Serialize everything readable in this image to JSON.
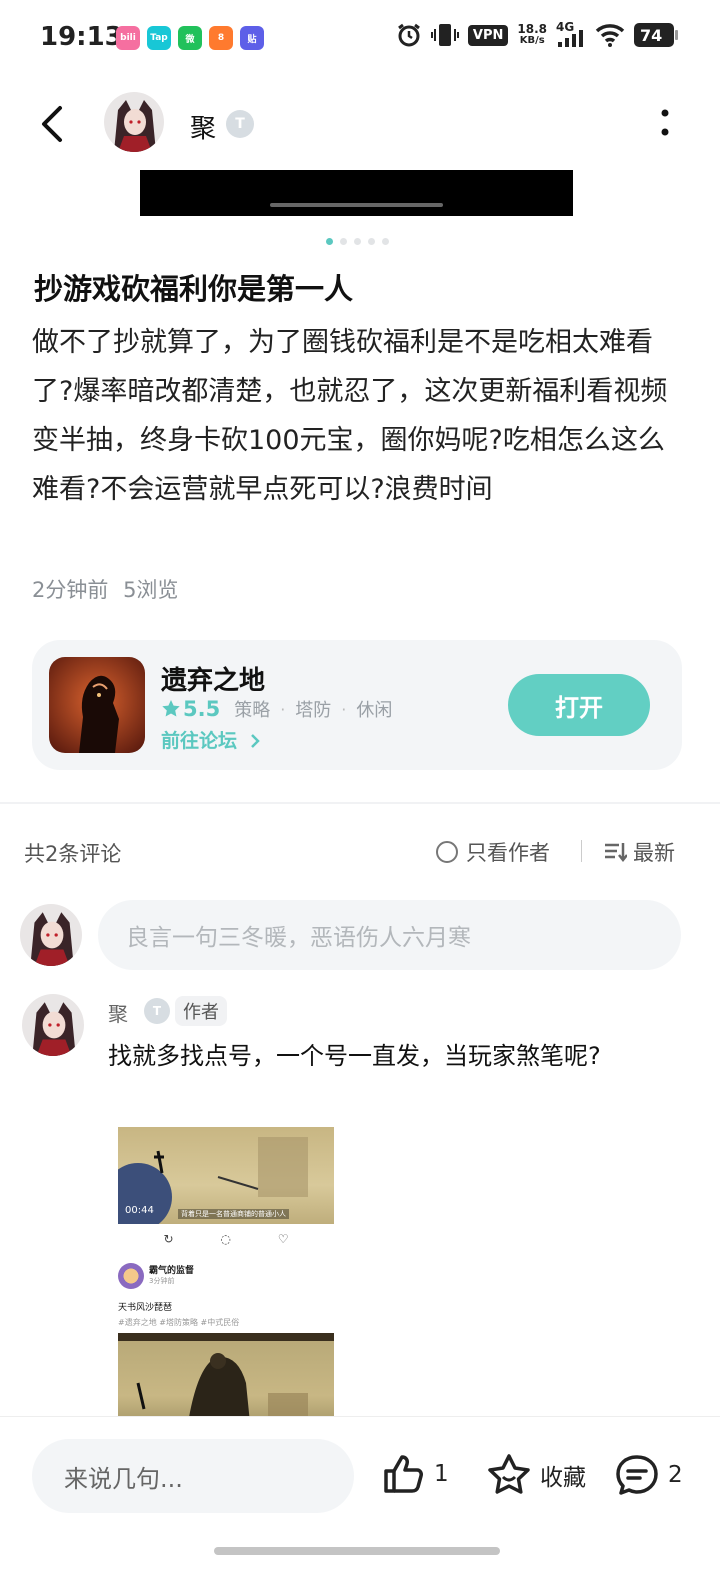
{
  "status_bar": {
    "time": "19:13",
    "apps": [
      {
        "icon": "bilibili-icon",
        "label": "bili",
        "color": "#f56fa0"
      },
      {
        "icon": "taptap-icon",
        "label": "Tap",
        "color": "#18c7d6"
      },
      {
        "icon": "wechat-icon",
        "label": "微",
        "color": "#21c15b"
      },
      {
        "icon": "app-icon",
        "label": "8",
        "color": "#ff7a2e"
      },
      {
        "icon": "app-icon",
        "label": "贴",
        "color": "#5d5fe8"
      }
    ],
    "vpn": "VPN",
    "speed_value": "18.8",
    "speed_unit": "KB/s",
    "network": "4G",
    "battery": "74"
  },
  "header": {
    "author_name": "聚",
    "level_badge": "T"
  },
  "post": {
    "title": "抄游戏砍福利你是第一人",
    "body": "做不了抄就算了，为了圈钱砍福利是不是吃相太难看了?爆率暗改都清楚，也就忍了，这次更新福利看视频变半抽，终身卡砍100元宝，圈你妈呢?吃相怎么这么难看?不会运营就早点死可以?浪费时间",
    "time_ago": "2分钟前",
    "views": "5浏览"
  },
  "game": {
    "name": "遗弃之地",
    "rating": "5.5",
    "tags": [
      "策略",
      "塔防",
      "休闲"
    ],
    "forum_link": "前往论坛",
    "open_button": "打开",
    "accent": "#5bc8c0"
  },
  "comments": {
    "count_label": "共2条评论",
    "only_author": "只看作者",
    "sort": "最新",
    "input_placeholder": "良言一句三冬暖，恶语伤人六月寒",
    "items": [
      {
        "author": "聚",
        "level_badge": "T",
        "author_tag": "作者",
        "text": "找就多找点号，一个号一直发，当玩家煞笔呢?",
        "image": {
          "video_time": "00:44",
          "video_subtitle": "背着只是一名普通商铺的普通小人",
          "user_name": "霸气的监督",
          "user_time": "3分钟前",
          "post_title": "天书风沙琵琶",
          "post_tags": "#遗弃之地 #塔防策略 #中式民俗"
        }
      }
    ]
  },
  "bottom_bar": {
    "input_placeholder": "来说几句...",
    "likes": "1",
    "favorite": "收藏",
    "comments": "2"
  }
}
